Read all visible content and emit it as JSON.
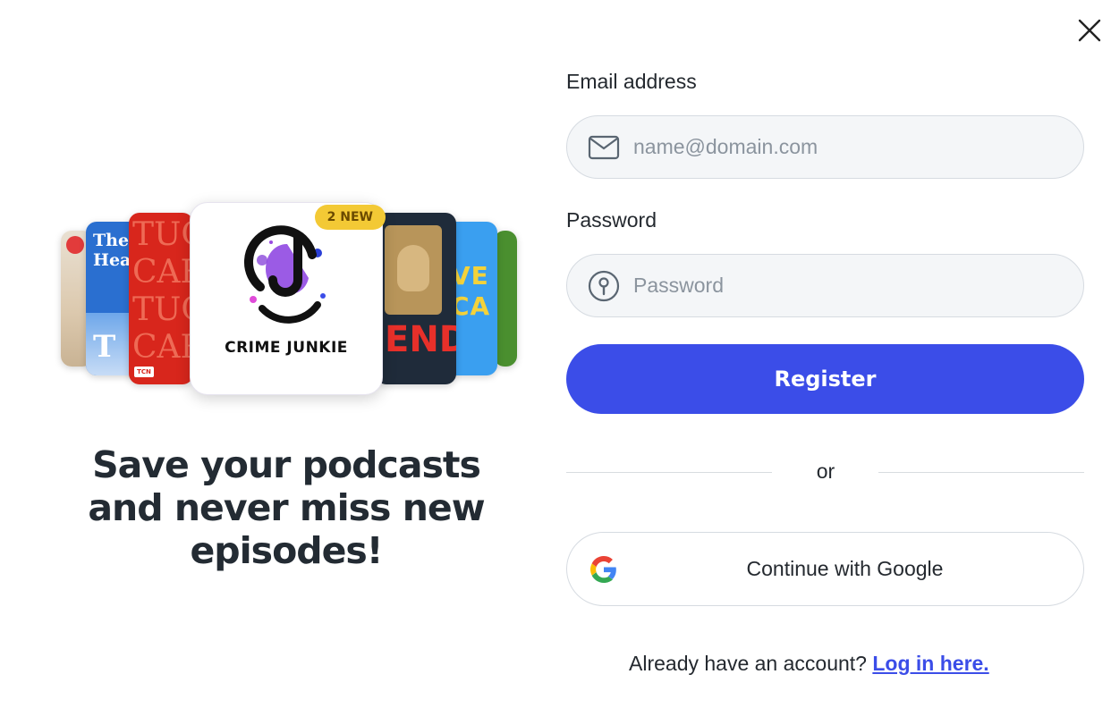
{
  "promo": {
    "badge": "2 NEW",
    "featured_title": "CRIME JUNKIE",
    "cover_b_title": "The Hea",
    "cover_c_title": "TUC CAR TUC CAR",
    "cover_d_title": "END",
    "cover_e_title": "VE CA",
    "headline": "Save your podcasts and never miss new episodes!"
  },
  "form": {
    "email_label": "Email address",
    "email_placeholder": "name@domain.com",
    "password_label": "Password",
    "password_placeholder": "Password",
    "register_label": "Register",
    "divider_text": "or",
    "google_label": "Continue with Google",
    "login_prompt": "Already have an account?",
    "login_link": "Log in here."
  },
  "colors": {
    "primary": "#3b4de8",
    "badge": "#f3c935"
  },
  "icons": [
    "close-icon",
    "mail-icon",
    "lock-icon",
    "google-icon"
  ]
}
